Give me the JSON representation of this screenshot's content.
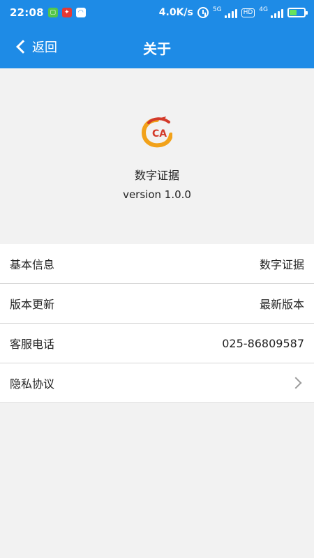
{
  "status_bar": {
    "time": "22:08",
    "speed": "4.0K/s",
    "net1_label": "5G",
    "net2_label": "4G",
    "hd_label": "HD",
    "app_icons": [
      "message-app-icon",
      "game-app-icon",
      "cloud-app-icon"
    ]
  },
  "app_bar": {
    "back_label": "返回",
    "title": "关于"
  },
  "about": {
    "logo_text": "CA",
    "app_name": "数字证据",
    "version": "version 1.0.0"
  },
  "list": {
    "items": [
      {
        "label": "基本信息",
        "value": "数字证据"
      },
      {
        "label": "版本更新",
        "value": "最新版本"
      },
      {
        "label": "客服电话",
        "value": "025-86809587"
      },
      {
        "label": "隐私协议",
        "value": ""
      }
    ]
  },
  "colors": {
    "primary": "#1e8be6",
    "background": "#f2f2f2",
    "logo_orange": "#f2a21a",
    "logo_red": "#d33a2a"
  }
}
